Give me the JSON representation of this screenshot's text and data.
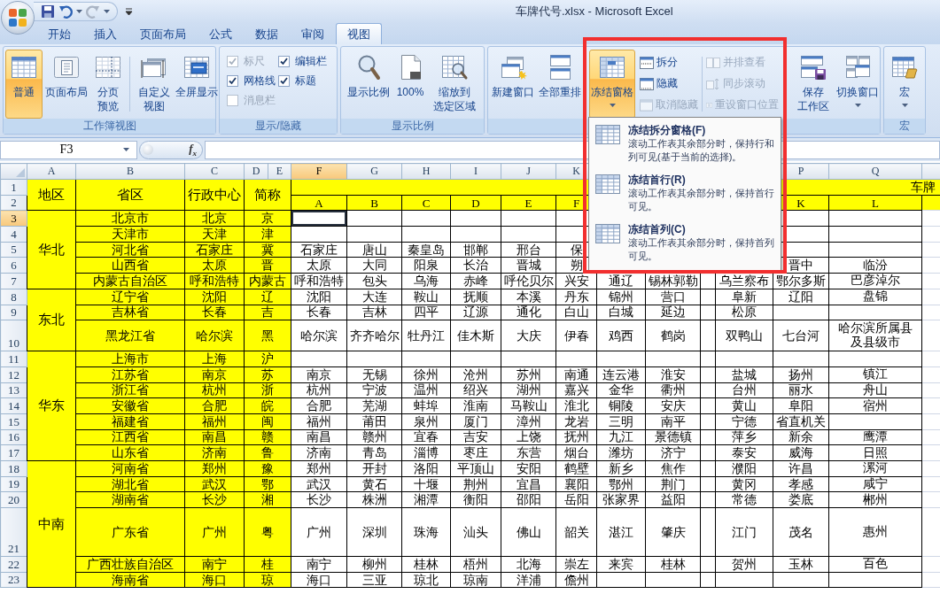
{
  "title_bar": {
    "title": "车牌代号.xlsx - Microsoft Excel"
  },
  "ribbon_tabs": [
    {
      "label": "开始",
      "selected": false
    },
    {
      "label": "插入",
      "selected": false
    },
    {
      "label": "页面布局",
      "selected": false
    },
    {
      "label": "公式",
      "selected": false
    },
    {
      "label": "数据",
      "selected": false
    },
    {
      "label": "审阅",
      "selected": false
    },
    {
      "label": "视图",
      "selected": true
    }
  ],
  "ribbon": {
    "groups": [
      {
        "label": "工作簿视图",
        "items": [
          {
            "kind": "large",
            "lines": [
              "普通"
            ],
            "selected": true,
            "dropdown": false
          },
          {
            "kind": "large",
            "lines": [
              "页面布局"
            ],
            "selected": false,
            "dropdown": false
          },
          {
            "kind": "large",
            "lines": [
              "分页",
              "预览"
            ],
            "selected": false,
            "dropdown": false
          },
          {
            "kind": "separator"
          },
          {
            "kind": "large",
            "lines": [
              "自定义",
              "视图"
            ],
            "selected": false,
            "dropdown": false
          },
          {
            "kind": "large",
            "lines": [
              "全屏显示"
            ],
            "selected": false,
            "dropdown": false
          }
        ]
      },
      {
        "label": "显示/隐藏",
        "items": [
          {
            "kind": "checks",
            "checks": [
              {
                "label": "标尺",
                "checked": true,
                "disabled": true
              },
              {
                "label": "网格线",
                "checked": true,
                "disabled": false
              },
              {
                "label": "消息栏",
                "checked": false,
                "disabled": true
              }
            ]
          },
          {
            "kind": "checks",
            "checks": [
              {
                "label": "编辑栏",
                "checked": true,
                "disabled": false
              },
              {
                "label": "标题",
                "checked": true,
                "disabled": false
              }
            ]
          }
        ]
      },
      {
        "label": "显示比例",
        "items": [
          {
            "kind": "large",
            "lines": [
              "显示比例"
            ],
            "selected": false,
            "dropdown": false
          },
          {
            "kind": "large",
            "lines": [
              "100%"
            ],
            "selected": false,
            "dropdown": false
          },
          {
            "kind": "large",
            "lines": [
              "缩放到",
              "选定区域"
            ],
            "selected": false,
            "dropdown": false
          }
        ]
      },
      {
        "items": [
          {
            "kind": "large",
            "lines": [
              "新建窗口"
            ],
            "selected": false,
            "dropdown": false
          },
          {
            "kind": "large",
            "lines": [
              "全部重排"
            ],
            "selected": false,
            "dropdown": false
          },
          {
            "kind": "large",
            "lines": [
              "冻结窗格"
            ],
            "selected": true,
            "dropdown": true
          },
          {
            "kind": "smalls",
            "buttons": [
              {
                "label": "拆分",
                "disabled": false
              },
              {
                "label": "隐藏",
                "disabled": false
              },
              {
                "label": "取消隐藏",
                "disabled": true
              }
            ]
          },
          {
            "kind": "separator"
          },
          {
            "kind": "smalls",
            "buttons": [
              {
                "label": "并排查看",
                "disabled": true
              },
              {
                "label": "同步滚动",
                "disabled": true
              },
              {
                "label": "重设窗口位置",
                "disabled": true
              }
            ]
          },
          {
            "kind": "large",
            "lines": [
              "保存",
              "工作区"
            ],
            "selected": false,
            "dropdown": false
          },
          {
            "kind": "large",
            "lines": [
              "切换窗口"
            ],
            "selected": false,
            "dropdown": true
          }
        ]
      },
      {
        "label": "宏",
        "items": [
          {
            "kind": "large",
            "lines": [
              "宏"
            ],
            "selected": false,
            "dropdown": true
          }
        ]
      }
    ]
  },
  "formula_bar": {
    "name_box": "F3",
    "function_button": "f$_{x}$"
  },
  "freeze_menu": {
    "items": [
      {
        "title": "冻结拆分窗格(F)",
        "description": "滚动工作表其余部分时，保持行和列可见(基于当前的选择)。"
      },
      {
        "title": "冻结首行(R)",
        "description": "滚动工作表其余部分时，保持首行可见。"
      },
      {
        "title": "冻结首列(C)",
        "description": "滚动工作表其余部分时，保持首列可见。"
      }
    ]
  },
  "sheet": {
    "column_headers": {
      "A": {
        "label": "A",
        "selected": false
      },
      "B": {
        "label": "B",
        "selected": false
      },
      "C": {
        "label": "C",
        "selected": false
      },
      "D": {
        "label": "D",
        "selected": false
      },
      "E": {
        "label": "E",
        "selected": false
      },
      "F": {
        "label": "F",
        "selected": true
      },
      "G": {
        "label": "G",
        "selected": false
      },
      "H": {
        "label": "H",
        "selected": false
      },
      "I": {
        "label": "I",
        "selected": false
      },
      "J": {
        "label": "J",
        "selected": false
      },
      "K": {
        "label": "K",
        "selected": false
      },
      "P": {
        "label": "P",
        "selected": false
      },
      "Q": {
        "label": "Q",
        "selected": false
      }
    },
    "row_headers": [
      {
        "label": "1",
        "selected": false
      },
      {
        "label": "2",
        "selected": false
      },
      {
        "label": "3",
        "selected": true
      },
      {
        "label": "4",
        "selected": false
      },
      {
        "label": "5",
        "selected": false
      },
      {
        "label": "6",
        "selected": false
      },
      {
        "label": "7",
        "selected": false
      },
      {
        "label": "8",
        "selected": false
      },
      {
        "label": "9",
        "selected": false
      },
      {
        "label": "10",
        "selected": false
      },
      {
        "label": "11",
        "selected": false
      },
      {
        "label": "12",
        "selected": false
      },
      {
        "label": "13",
        "selected": false
      },
      {
        "label": "14",
        "selected": false
      },
      {
        "label": "15",
        "selected": false
      },
      {
        "label": "16",
        "selected": false
      },
      {
        "label": "17",
        "selected": false
      },
      {
        "label": "18",
        "selected": false
      },
      {
        "label": "19",
        "selected": false
      },
      {
        "label": "20",
        "selected": false
      },
      {
        "label": "21",
        "selected": false
      },
      {
        "label": "22",
        "selected": false
      },
      {
        "label": "23",
        "selected": false
      }
    ],
    "header": {
      "labels": [
        "地区",
        "省区",
        "行政中心",
        "简称"
      ],
      "plates_title": "车牌",
      "plate_letters": {
        "F": "A",
        "G": "B",
        "H": "C",
        "I": "D",
        "J": "E",
        "K": "F",
        "P": "K",
        "Q": "L"
      }
    },
    "regions": [
      {
        "name": "华北",
        "provinces": [
          {
            "province": "北京市",
            "capital": "北京",
            "abbr": "京"
          },
          {
            "province": "天津市",
            "capital": "天津",
            "abbr": "津"
          },
          {
            "province": "河北省",
            "capital": "石家庄",
            "abbr": "冀",
            "cities": {
              "F": "石家庄",
              "G": "唐山",
              "H": "秦皇岛",
              "I": "邯郸",
              "J": "邢台",
              "K": "保"
            }
          },
          {
            "province": "山西省",
            "capital": "太原",
            "abbr": "晋",
            "cities": {
              "F": "太原",
              "G": "大同",
              "H": "阳泉",
              "I": "长治",
              "J": "晋城",
              "K": "朔",
              "P": "晋中",
              "Q": "临汾"
            }
          },
          {
            "province": "内蒙古自治区",
            "capital": "呼和浩特",
            "abbr": "内蒙古",
            "cities": {
              "F": "呼和浩特",
              "G": "包头",
              "H": "乌海",
              "I": "赤峰",
              "J": "呼伦贝尔",
              "K": "兴安",
              "L": "通辽",
              "M": "锡林郭勒",
              "O": "乌兰察布",
              "P": "鄂尔多斯",
              "Q": "巴彦淖尔"
            }
          }
        ]
      },
      {
        "name": "东北",
        "provinces": [
          {
            "province": "辽宁省",
            "capital": "沈阳",
            "abbr": "辽",
            "cities": {
              "F": "沈阳",
              "G": "大连",
              "H": "鞍山",
              "I": "抚顺",
              "J": "本溪",
              "K": "丹东",
              "L": "锦州",
              "M": "营口",
              "O": "阜新",
              "P": "辽阳",
              "Q": "盘锦"
            }
          },
          {
            "province": "吉林省",
            "capital": "长春",
            "abbr": "吉",
            "cities": {
              "F": "长春",
              "G": "吉林",
              "H": "四平",
              "I": "辽源",
              "J": "通化",
              "K": "白山",
              "L": "白城",
              "M": "延边",
              "O": "松原"
            }
          },
          {
            "province": "黑龙江省",
            "capital": "哈尔滨",
            "abbr": "黑",
            "cities": {
              "F": "哈尔滨",
              "G": "齐齐哈尔",
              "H": "牡丹江",
              "I": "佳木斯",
              "J": "大庆",
              "K": "伊春",
              "L": "鸡西",
              "M": "鹤岗",
              "O": "双鸭山",
              "P": "七台河",
              "Q": "哈尔滨所属县及县级市"
            }
          }
        ]
      },
      {
        "name": "华东",
        "provinces": [
          {
            "province": "上海市",
            "capital": "上海",
            "abbr": "沪"
          },
          {
            "province": "江苏省",
            "capital": "南京",
            "abbr": "苏",
            "cities": {
              "F": "南京",
              "G": "无锡",
              "H": "徐州",
              "I": "沧州",
              "J": "苏州",
              "K": "南通",
              "L": "连云港",
              "M": "淮安",
              "O": "盐城",
              "P": "扬州",
              "Q": "镇江"
            }
          },
          {
            "province": "浙江省",
            "capital": "杭州",
            "abbr": "浙",
            "cities": {
              "F": "杭州",
              "G": "宁波",
              "H": "温州",
              "I": "绍兴",
              "J": "湖州",
              "K": "嘉兴",
              "L": "金华",
              "M": "衢州",
              "O": "台州",
              "P": "丽水",
              "Q": "舟山"
            }
          },
          {
            "province": "安徽省",
            "capital": "合肥",
            "abbr": "皖",
            "cities": {
              "F": "合肥",
              "G": "芜湖",
              "H": "蚌埠",
              "I": "淮南",
              "J": "马鞍山",
              "K": "淮北",
              "L": "铜陵",
              "M": "安庆",
              "O": "黄山",
              "P": "阜阳",
              "Q": "宿州"
            }
          },
          {
            "province": "福建省",
            "capital": "福州",
            "abbr": "闽",
            "cities": {
              "F": "福州",
              "G": "莆田",
              "H": "泉州",
              "I": "厦门",
              "J": "漳州",
              "K": "龙岩",
              "L": "三明",
              "M": "南平",
              "O": "宁德",
              "P": "省直机关"
            }
          },
          {
            "province": "江西省",
            "capital": "南昌",
            "abbr": "赣",
            "cities": {
              "F": "南昌",
              "G": "赣州",
              "H": "宜春",
              "I": "吉安",
              "J": "上饶",
              "K": "抚州",
              "L": "九江",
              "M": "景德镇",
              "O": "萍乡",
              "P": "新余",
              "Q": "鹰潭"
            }
          },
          {
            "province": "山东省",
            "capital": "济南",
            "abbr": "鲁",
            "cities": {
              "F": "济南",
              "G": "青岛",
              "H": "淄博",
              "I": "枣庄",
              "J": "东营",
              "K": "烟台",
              "L": "潍坊",
              "M": "济宁",
              "O": "泰安",
              "P": "威海",
              "Q": "日照"
            }
          }
        ]
      },
      {
        "name": "中南",
        "provinces": [
          {
            "province": "河南省",
            "capital": "郑州",
            "abbr": "豫",
            "cities": {
              "F": "郑州",
              "G": "开封",
              "H": "洛阳",
              "I": "平顶山",
              "J": "安阳",
              "K": "鹤壁",
              "L": "新乡",
              "M": "焦作",
              "O": "濮阳",
              "P": "许昌",
              "Q": "漯河"
            }
          },
          {
            "province": "湖北省",
            "capital": "武汉",
            "abbr": "鄂",
            "cities": {
              "F": "武汉",
              "G": "黄石",
              "H": "十堰",
              "I": "荆州",
              "J": "宜昌",
              "K": "襄阳",
              "L": "鄂州",
              "M": "荆门",
              "O": "黄冈",
              "P": "孝感",
              "Q": "咸宁"
            }
          },
          {
            "province": "湖南省",
            "capital": "长沙",
            "abbr": "湘",
            "cities": {
              "F": "长沙",
              "G": "株洲",
              "H": "湘潭",
              "I": "衡阳",
              "J": "邵阳",
              "K": "岳阳",
              "L": "张家界",
              "M": "益阳",
              "O": "常德",
              "P": "娄底",
              "Q": "郴州"
            }
          },
          {
            "province": "广东省",
            "capital": "广州",
            "abbr": "粤",
            "cities": {
              "F": "广州",
              "G": "深圳",
              "H": "珠海",
              "I": "汕头",
              "J": "佛山",
              "K": "韶关",
              "L": "湛江",
              "M": "肇庆",
              "O": "江门",
              "P": "茂名",
              "Q": "惠州"
            }
          },
          {
            "province": "广西壮族自治区",
            "capital": "南宁",
            "abbr": "桂",
            "cities": {
              "F": "南宁",
              "G": "柳州",
              "H": "桂林",
              "I": "梧州",
              "J": "北海",
              "K": "崇左",
              "L": "来宾",
              "M": "桂林",
              "O": "贺州",
              "P": "玉林",
              "Q": "百色"
            }
          },
          {
            "province": "海南省",
            "capital": "海口",
            "abbr": "琼",
            "cities": {
              "F": "海口",
              "G": "三亚",
              "H": "琼北",
              "I": "琼南",
              "J": "洋浦",
              "K": "儋州"
            }
          }
        ]
      }
    ]
  }
}
